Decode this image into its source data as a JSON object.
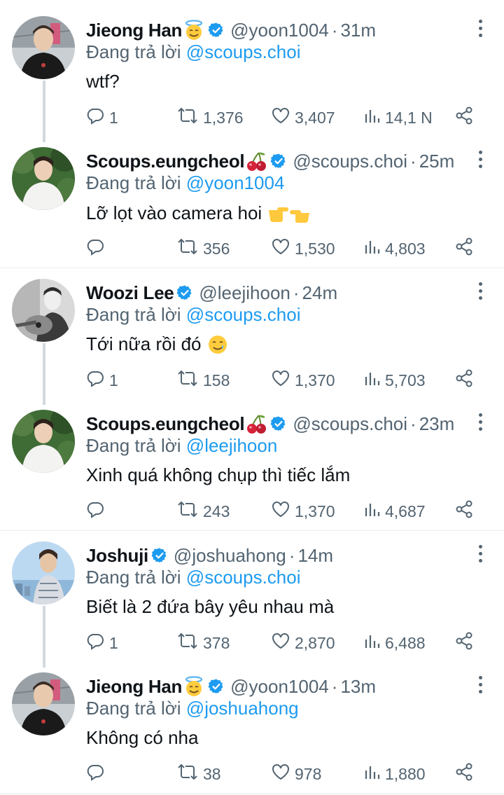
{
  "reply_prefix": "Đang trả lời",
  "colors": {
    "link": "#1d9bf0",
    "secondary": "#536471",
    "verified": "#1d9bf0",
    "separator": "#e6ecf0",
    "thread_line": "#d2d8dc"
  },
  "tweets": [
    {
      "name": "Jieong Han",
      "name_emoji": "halo-smile-emoji",
      "handle": "@yoon1004",
      "time": "31m",
      "reply_to": "@scoups.choi",
      "text": "wtf?",
      "text_emoji": "",
      "replies": "1",
      "retweets": "1,376",
      "likes": "3,407",
      "views": "14,1 N",
      "avatar": "black-shirt-man"
    },
    {
      "name": "Scoups.eungcheol",
      "name_emoji": "cherries-emoji",
      "handle": "@scoups.choi",
      "time": "25m",
      "reply_to": "@yoon1004",
      "text": "Lỡ lọt vào camera hoi",
      "text_emoji": "pointing-hands-emoji",
      "replies": "",
      "retweets": "356",
      "likes": "1,530",
      "views": "4,803",
      "avatar": "white-shirt-man"
    },
    {
      "name": "Woozi Lee",
      "name_emoji": "",
      "handle": "@leejihoon",
      "time": "24m",
      "reply_to": "@scoups.choi",
      "text": "Tới nữa rồi đó",
      "text_emoji": "smiling-tear-emoji",
      "replies": "1",
      "retweets": "158",
      "likes": "1,370",
      "views": "5,703",
      "avatar": "guitar-bw"
    },
    {
      "name": "Scoups.eungcheol",
      "name_emoji": "cherries-emoji",
      "handle": "@scoups.choi",
      "time": "23m",
      "reply_to": "@leejihoon",
      "text": "Xinh quá không chụp thì tiếc lắm",
      "text_emoji": "",
      "replies": "",
      "retweets": "243",
      "likes": "1,370",
      "views": "4,687",
      "avatar": "white-shirt-man"
    },
    {
      "name": "Joshuji",
      "name_emoji": "",
      "handle": "@joshuahong",
      "time": "14m",
      "reply_to": "@scoups.choi",
      "text": "Biết là 2 đứa bây yêu nhau mà",
      "text_emoji": "",
      "replies": "1",
      "retweets": "378",
      "likes": "2,870",
      "views": "6,488",
      "avatar": "blue-sky-man"
    },
    {
      "name": "Jieong Han",
      "name_emoji": "halo-smile-emoji",
      "handle": "@yoon1004",
      "time": "13m",
      "reply_to": "@joshuahong",
      "text": "Không có nha",
      "text_emoji": "",
      "replies": "",
      "retweets": "38",
      "likes": "978",
      "views": "1,880",
      "avatar": "black-shirt-man"
    }
  ]
}
